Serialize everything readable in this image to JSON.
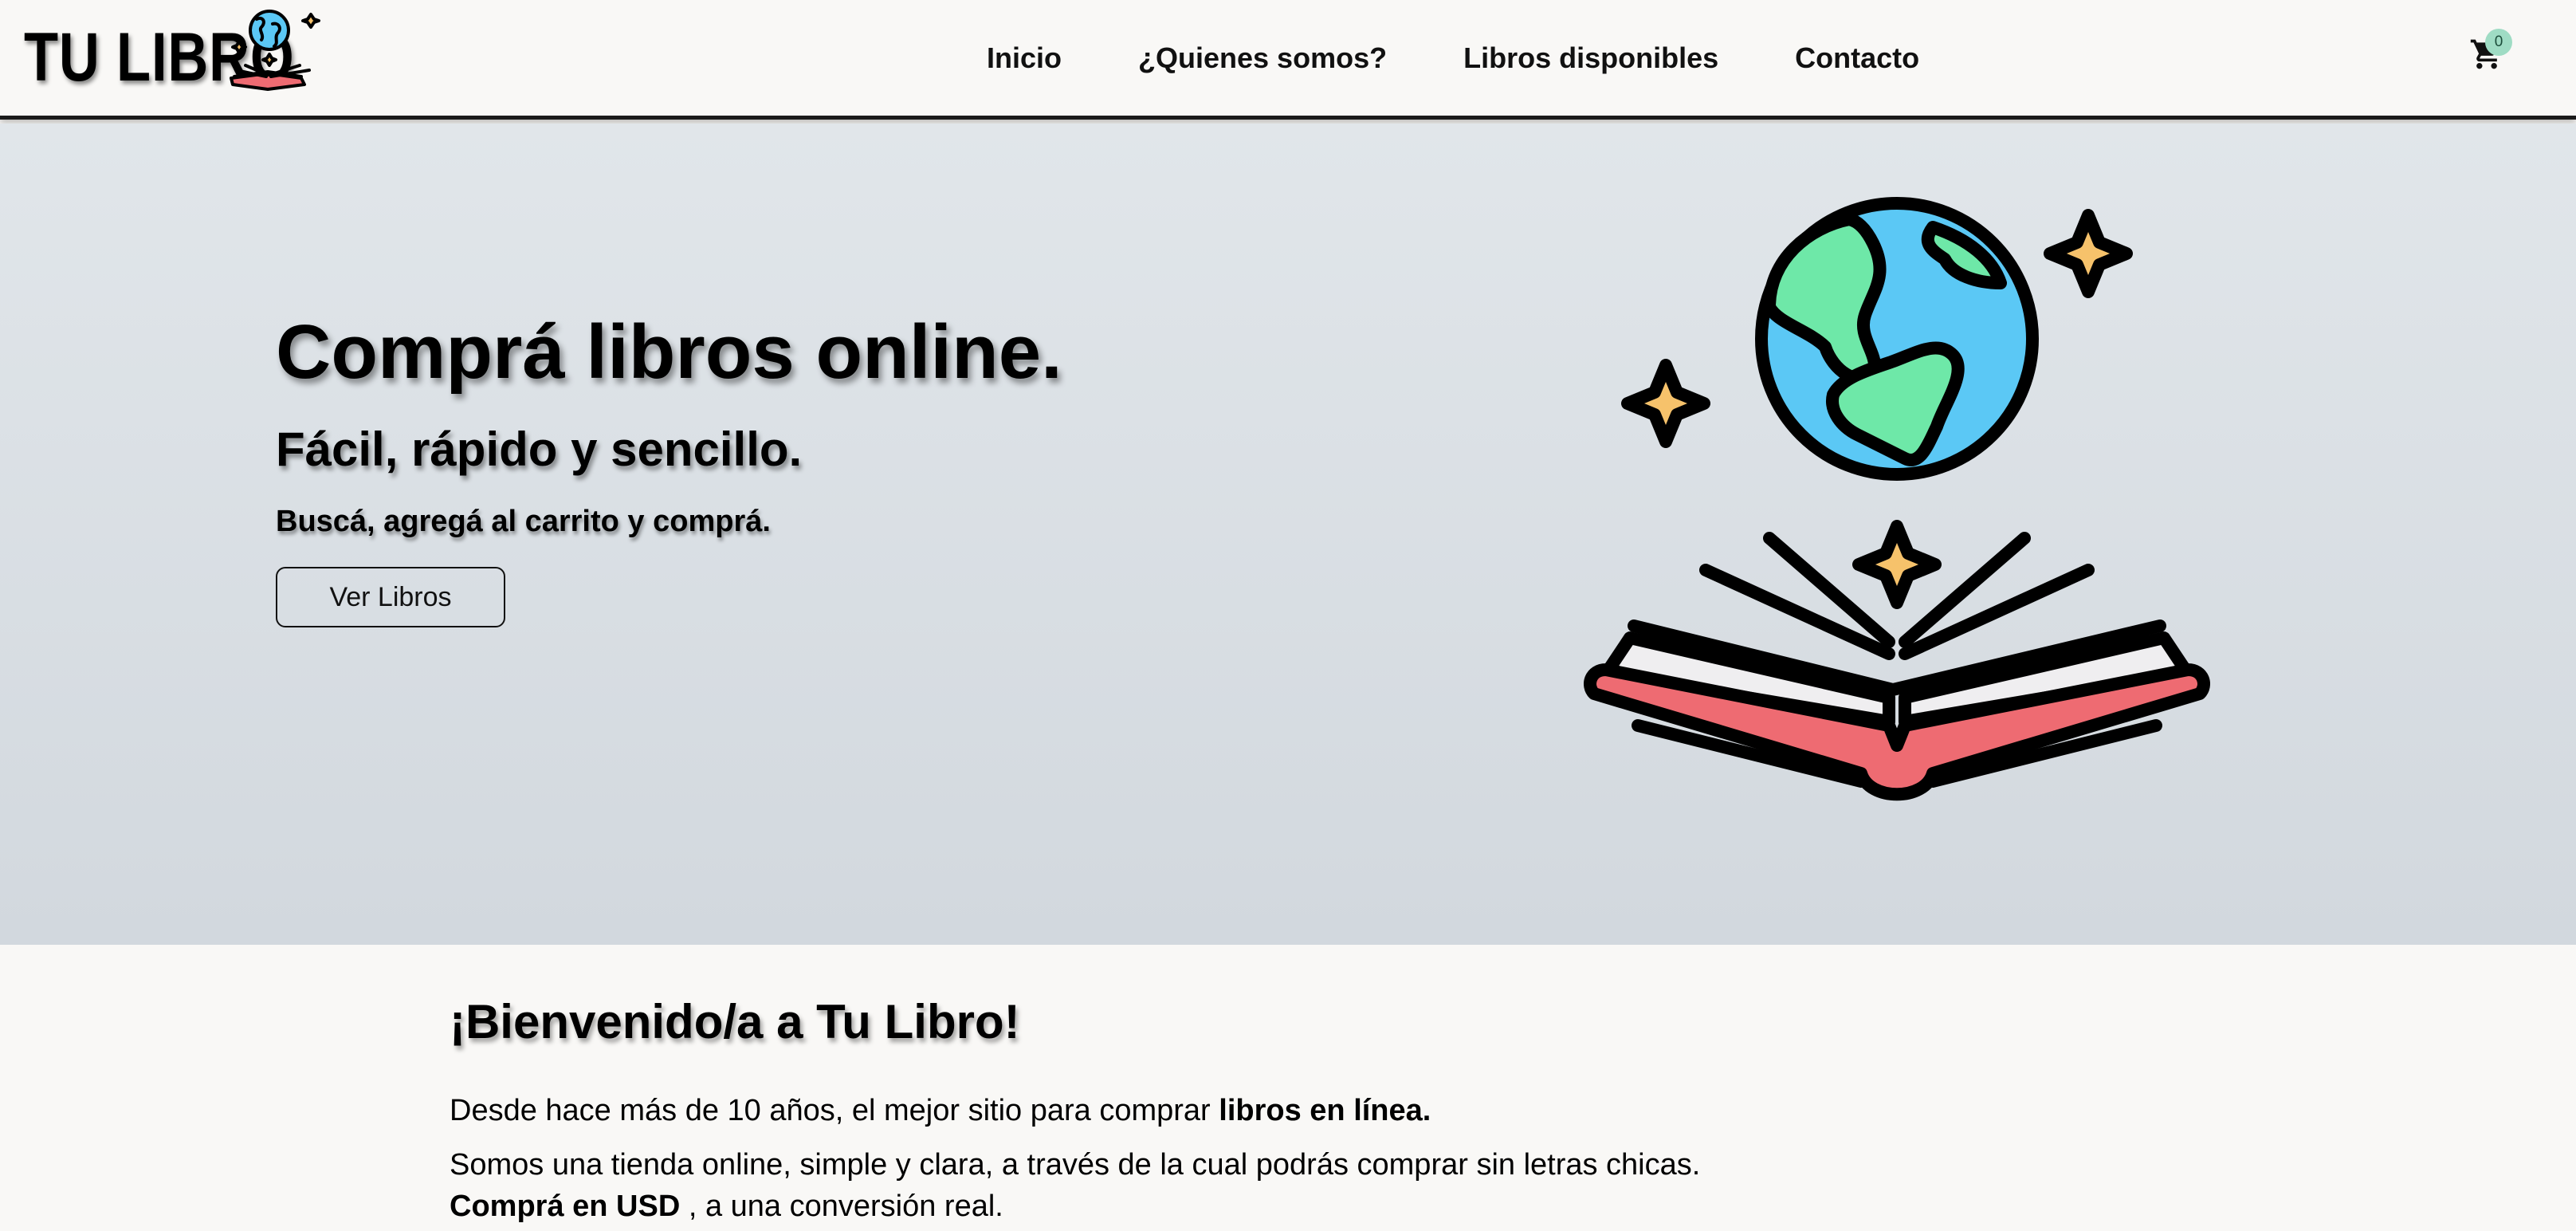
{
  "brand": {
    "name": "TU LIBRO",
    "logo_icon": "globe-book-icon"
  },
  "nav": {
    "items": [
      {
        "label": "Inicio"
      },
      {
        "label": "¿Quienes somos?"
      },
      {
        "label": "Libros disponibles"
      },
      {
        "label": "Contacto"
      }
    ],
    "cart_icon": "cart-icon",
    "cart_count": "0"
  },
  "hero": {
    "title": "Comprá libros online.",
    "subtitle": "Fácil, rápido y sencillo.",
    "tagline": "Buscá, agregá al carrito y comprá.",
    "button_label": "Ver Libros",
    "illustration_icon": "globe-open-book-icon"
  },
  "welcome": {
    "title": "¡Bienvenido/a a Tu Libro!",
    "p1_text": "Desde hace más de 10 años, el mejor sitio para comprar ",
    "p1_bold": "libros en línea.",
    "p2_text": "Somos una tienda online, simple y clara, a través de la cual podrás comprar sin letras chicas.",
    "p3_bold": "Comprá en USD",
    "p3_text": " , a una conversión real."
  },
  "colors": {
    "globe_water": "#5bc8f5",
    "globe_land": "#6ee8a8",
    "sparkle": "#f6c26b",
    "book_cover": "#ee6b72",
    "book_pages": "#efeef0",
    "badge": "#9fdcc4"
  }
}
